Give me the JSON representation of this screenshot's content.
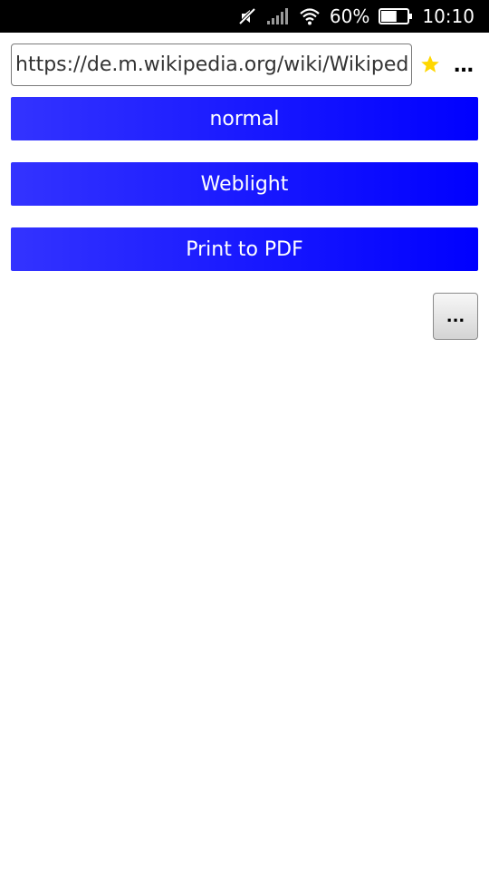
{
  "status_bar": {
    "battery_percent": "60%",
    "time": "10:10",
    "battery_level": 0.6
  },
  "url_bar": {
    "value": "https://de.m.wikipedia.org/wiki/Wikipedia",
    "star_color": "#ffd700"
  },
  "buttons": {
    "normal": "normal",
    "weblight": "Weblight",
    "print_pdf": "Print to PDF",
    "more": "...",
    "top_more": "…"
  },
  "colors": {
    "button_blue": "#0000ff",
    "status_bar_bg": "#000000"
  }
}
